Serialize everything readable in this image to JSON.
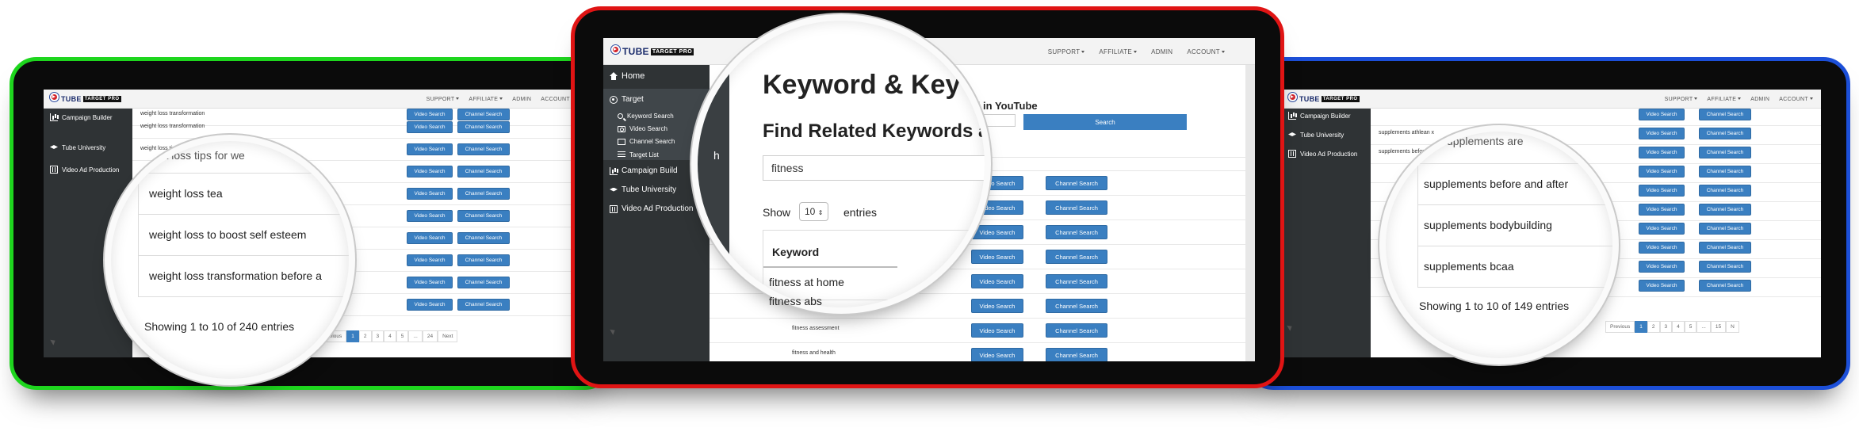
{
  "nav_menu": {
    "support": "SUPPORT",
    "affiliate": "AFFILIATE",
    "admin": "ADMIN",
    "account": "ACCOUNT"
  },
  "logo": {
    "title": "TUBE",
    "sub": "TARGET PRO"
  },
  "sidebar": {
    "home": "Home",
    "target": "Target",
    "keyword_search": "Keyword Search",
    "video_search": "Video Search",
    "channel_search": "Channel Search",
    "target_list": "Target List",
    "campaign_builder": "Campaign Builder",
    "campaign_builder_short": "Campaign Build",
    "tube_university": "Tube University",
    "video_ad_production": "Video Ad Production"
  },
  "buttons": {
    "video_search": "Video Search",
    "channel_search": "Channel Search",
    "search": "Search"
  },
  "left_panel": {
    "rows": [
      "weight loss transformation",
      "weight loss tips for w",
      "",
      "",
      "",
      "",
      "",
      "",
      ""
    ],
    "pager": [
      "Previous",
      "1",
      "2",
      "3",
      "4",
      "5",
      "...",
      "24",
      "Next"
    ],
    "magnifier": {
      "partial": "eight loss tips for we",
      "items": [
        "weight loss tea",
        "weight loss to boost self esteem",
        "weight loss transformation before a"
      ],
      "info": "Showing 1 to 10 of 240 entries"
    }
  },
  "center_panel": {
    "right_header": "rched in YouTube",
    "rows": [
      "",
      "",
      "",
      "",
      "",
      "",
      "fitness abs",
      "fitness assessment",
      "fitness and health"
    ],
    "magnifier": {
      "title": "Keyword & Key",
      "subtitle": "Find Related Keywords a",
      "search_value": "fitness",
      "show_label": "Show",
      "entries_value": "10",
      "entries_label": "entries",
      "col_header": "Keyword",
      "items": [
        "fitness at home",
        "fitness abs"
      ]
    },
    "sidebar_zoom": "Channel Search",
    "sidebar_zoom_tail": "h"
  },
  "right_panel": {
    "rows": [
      "supplements athlean x",
      "supplements before",
      "",
      "",
      "",
      "",
      "",
      "",
      ""
    ],
    "pager": [
      "Previous",
      "1",
      "2",
      "3",
      "4",
      "5",
      "...",
      "15",
      "N"
    ],
    "magnifier": {
      "partial": "supplements are",
      "items": [
        "supplements before and after",
        "supplements bodybuilding",
        "supplements bcaa"
      ],
      "info": "Showing 1 to 10 of 149 entries"
    }
  },
  "colors": {
    "green": "#1ed61e",
    "red": "#e01414",
    "blue": "#1c4fd8",
    "button": "#3a7fc1",
    "sidebar": "#2f3335"
  }
}
